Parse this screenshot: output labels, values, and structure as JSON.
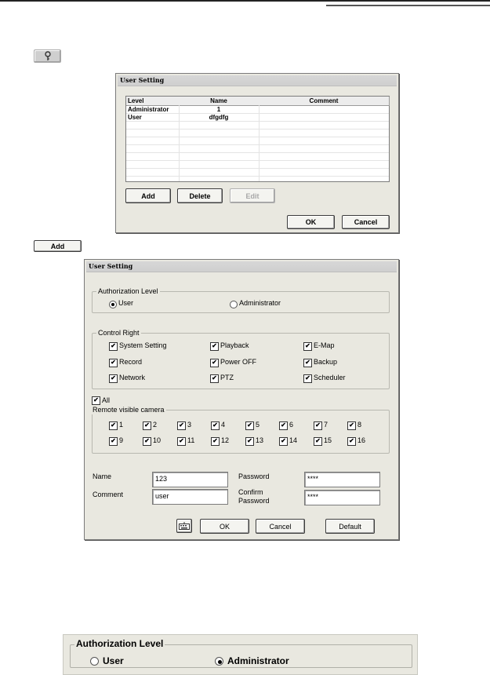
{
  "top_add_button_label": "Add",
  "dialog1": {
    "title": "User Setting",
    "columns": [
      "Level",
      "Name",
      "Comment"
    ],
    "rows": [
      {
        "level": "Administrator",
        "name": "1",
        "comment": ""
      },
      {
        "level": "User",
        "name": "dfgdfg",
        "comment": ""
      }
    ],
    "buttons": {
      "add": "Add",
      "delete": "Delete",
      "edit": "Edit",
      "ok": "OK",
      "cancel": "Cancel"
    }
  },
  "dialog2": {
    "title": "User Setting",
    "auth": {
      "label": "Authorization Level",
      "user": "User",
      "admin": "Administrator",
      "selected": "User"
    },
    "control": {
      "label": "Control Right",
      "items": {
        "system_setting": "System Setting",
        "playback": "Playback",
        "emap": "E-Map",
        "record": "Record",
        "power_off": "Power OFF",
        "backup": "Backup",
        "network": "Network",
        "ptz": "PTZ",
        "scheduler": "Scheduler"
      }
    },
    "all_label": "All",
    "cameras_label": "Remote visible camera",
    "cameras": [
      "1",
      "2",
      "3",
      "4",
      "5",
      "6",
      "7",
      "8",
      "9",
      "10",
      "11",
      "12",
      "13",
      "14",
      "15",
      "16"
    ],
    "name_label": "Name",
    "name_value": "123",
    "comment_label": "Comment",
    "comment_value": "user",
    "password_label": "Password",
    "password_value": "****",
    "confirm_label_1": "Confirm",
    "confirm_label_2": "Password",
    "confirm_value": "****",
    "buttons": {
      "ok": "OK",
      "cancel": "Cancel",
      "default": "Default"
    }
  },
  "crop": {
    "label": "Authorization Level",
    "user": "User",
    "admin": "Administrator",
    "selected": "Administrator"
  },
  "check_glyph": "✔"
}
